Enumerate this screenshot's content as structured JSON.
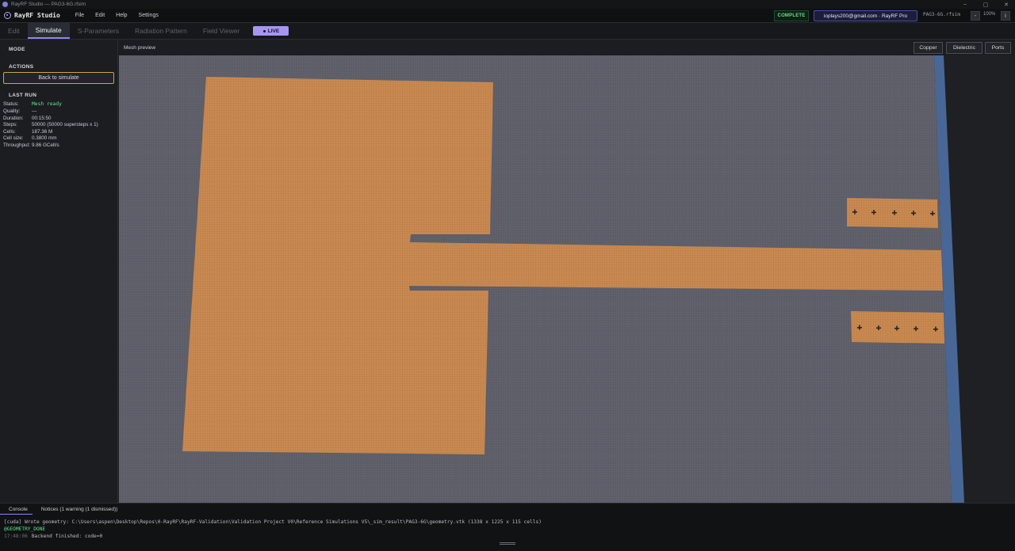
{
  "window": {
    "title": "RayRF Studio — PAG3-6G.rfsim",
    "controls": [
      "–",
      "▢",
      "✕"
    ]
  },
  "app": {
    "name": "RayRF Studio",
    "menu": [
      "File",
      "Edit",
      "Help",
      "Settings"
    ],
    "status": "COMPLETE",
    "account": "ioplays200@gmail.com · RayRF Pro",
    "filename": "PAG3-6G.rfsim",
    "zoom_minus": "-",
    "zoom": "100%",
    "zoom_info": "i"
  },
  "tabs": [
    {
      "label": "Edit",
      "active": false
    },
    {
      "label": "Simulate",
      "active": true
    },
    {
      "label": "S-Parameters",
      "active": false
    },
    {
      "label": "Radiation Pattern",
      "active": false
    },
    {
      "label": "Field Viewer",
      "active": false
    }
  ],
  "live_badge": "LIVE",
  "sidebar": {
    "mode_heading": "MODE",
    "actions_heading": "ACTIONS",
    "back_button": "Back to simulate",
    "last_run_heading": "LAST RUN",
    "last_run": [
      {
        "key": "Status:",
        "value": "Mesh ready"
      },
      {
        "key": "Quality:",
        "value": "—"
      },
      {
        "key": "Duration:",
        "value": "00:15:50"
      },
      {
        "key": "Steps:",
        "value": "50000 (50000 supersteps x 1)"
      },
      {
        "key": "Cells:",
        "value": "187.36 M"
      },
      {
        "key": "Cell size:",
        "value": "0.3800 mm"
      },
      {
        "key": "Throughput:",
        "value": "9.86 GCell/s"
      }
    ]
  },
  "viewport": {
    "label": "Mesh preview",
    "layer_buttons": [
      "Copper",
      "Dielectric",
      "Ports"
    ],
    "colors": {
      "dielectric": "#5b5c66",
      "copper": "#c98a52",
      "port_edge": "#4d6fa3",
      "via": "#2a2622"
    }
  },
  "console": {
    "tabs": [
      "Console",
      "Notices (1 warning (1 dismissed))"
    ],
    "line1": "[cuda] Wrote geometry: C:\\Users\\aspen\\Desktop\\Repos\\0-RayRF\\RayRF-Validation\\Validation Project V0\\Reference Simulations V5\\_sim_result\\PAG3-6G\\geometry.vtk  (1338 x 1225 x 115 cells)",
    "line2": "@GEOMETRY_DONE",
    "line3_time": "17:48:06",
    "line3": "Backend finished: code=0"
  }
}
